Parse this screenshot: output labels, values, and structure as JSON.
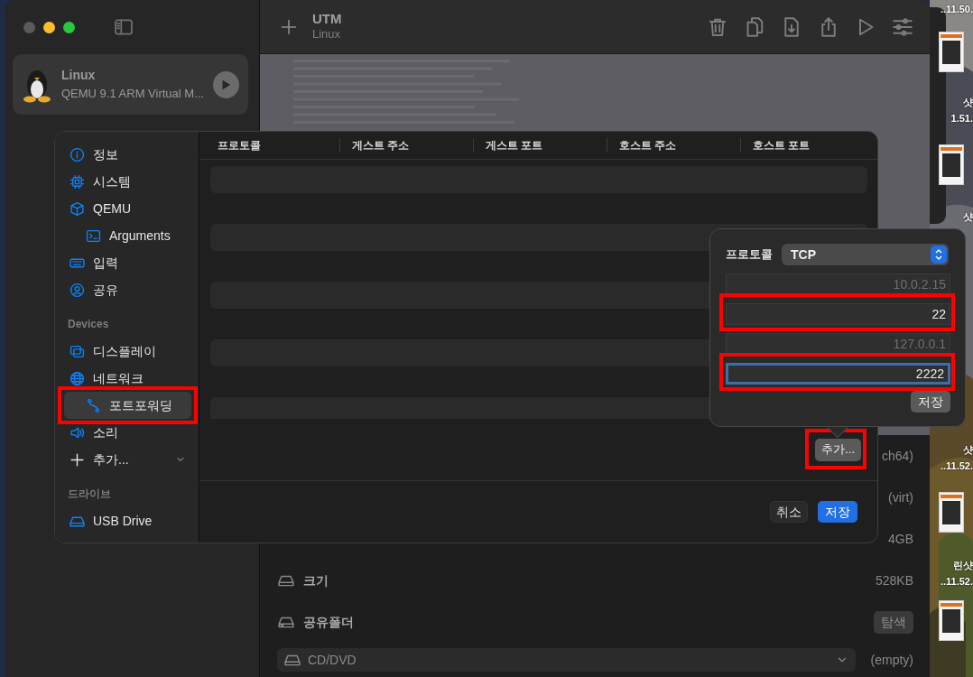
{
  "main_window": {
    "sidebar": {
      "vms": [
        {
          "name": "Linux",
          "subtitle": "QEMU 9.1 ARM Virtual M...",
          "selected": true
        }
      ]
    },
    "toolbar": {
      "title": "UTM",
      "subtitle": "Linux"
    },
    "details": [
      {
        "kind": "value",
        "value": "ch64)"
      },
      {
        "kind": "value",
        "value": "(virt)"
      },
      {
        "kind": "value",
        "value": "4GB"
      },
      {
        "kind": "value",
        "label": "크기",
        "value": "528KB"
      },
      {
        "kind": "button",
        "label": "공유폴더",
        "button": "탐색"
      },
      {
        "kind": "dropdown",
        "label": "CD/DVD",
        "value": "(empty)"
      }
    ]
  },
  "settings_sheet": {
    "sidebar": [
      {
        "items": [
          {
            "label": "정보",
            "kind": "item",
            "selected": false,
            "highlighted": false
          },
          {
            "label": "시스템",
            "kind": "item",
            "selected": false,
            "highlighted": false
          },
          {
            "label": "QEMU",
            "kind": "item",
            "selected": false,
            "highlighted": false,
            "children": [
              {
                "label": "Arguments",
                "kind": "item",
                "selected": false,
                "highlighted": false
              }
            ]
          },
          {
            "label": "입력",
            "kind": "item",
            "selected": false,
            "highlighted": false
          },
          {
            "label": "공유",
            "kind": "item",
            "selected": false,
            "highlighted": false
          }
        ]
      },
      {
        "header": "Devices",
        "items": [
          {
            "label": "디스플레이",
            "kind": "item",
            "selected": false,
            "highlighted": false
          },
          {
            "label": "네트워크",
            "kind": "item",
            "selected": false,
            "highlighted": false,
            "children": [
              {
                "label": "포트포워딩",
                "kind": "item",
                "selected": true,
                "highlighted": true
              }
            ]
          },
          {
            "label": "소리",
            "kind": "item",
            "selected": false,
            "highlighted": false
          },
          {
            "label": "추가...",
            "kind": "menu",
            "selected": false,
            "highlighted": false
          }
        ]
      },
      {
        "header": "드라이브",
        "items": [
          {
            "label": "USB Drive",
            "kind": "item",
            "selected": false,
            "highlighted": false
          }
        ]
      }
    ],
    "table": {
      "columns": [
        "프로토콜",
        "게스트 주소",
        "게스트 포트",
        "호스트 주소",
        "호스트 포트"
      ]
    },
    "add_button": {
      "label": "추가...",
      "highlighted": true
    },
    "buttons": [
      {
        "label": "취소",
        "kind": "secondary"
      },
      {
        "label": "저장",
        "kind": "primary"
      }
    ]
  },
  "popover": {
    "protocol_label": "프로토콜",
    "protocol": "TCP",
    "fields": [
      {
        "placeholder": "10.0.2.15",
        "focused": false,
        "highlighted": false
      },
      {
        "value": "22",
        "focused": false,
        "highlighted": true
      },
      {
        "placeholder": "127.0.0.1",
        "focused": false,
        "highlighted": false
      },
      {
        "value": "2222",
        "focused": true,
        "highlighted": true
      }
    ],
    "save_button": "저장"
  },
  "desktop": [
    {
      "kind": "label",
      "lines": [
        "..11.50."
      ]
    },
    {
      "kind": "thumbnail"
    },
    {
      "kind": "label",
      "lines": [
        "샷",
        "1.51."
      ]
    },
    {
      "kind": "thumbnail"
    },
    {
      "kind": "label",
      "lines": [
        "샷"
      ]
    },
    {
      "kind": "label",
      "lines": [
        "샷",
        "..11.52."
      ]
    },
    {
      "kind": "thumbnail"
    },
    {
      "kind": "label",
      "lines": [
        "린샷",
        "..11.52."
      ]
    },
    {
      "kind": "thumbnail"
    }
  ]
}
